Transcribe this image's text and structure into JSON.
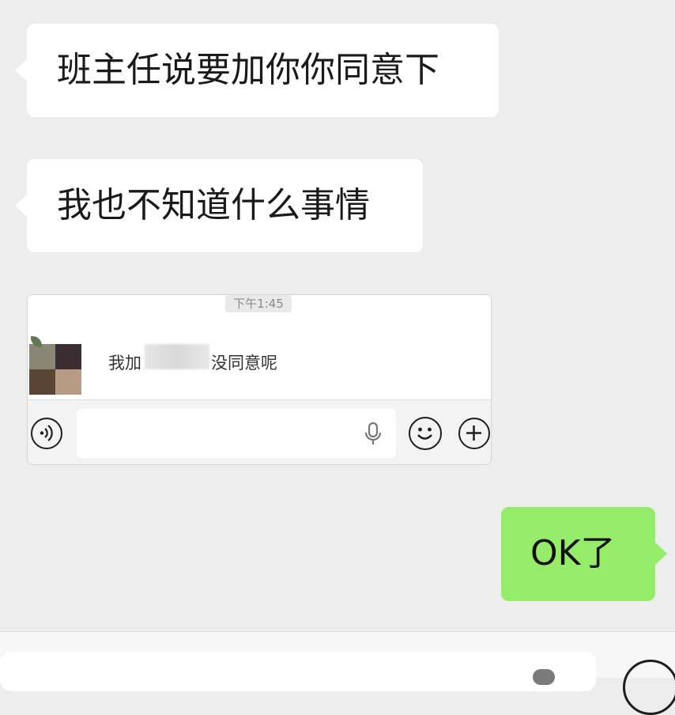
{
  "messages": {
    "m1": "班主任说要加你你同意下",
    "m2": "我也不知道什么事情",
    "reply": "OK了"
  },
  "screenshot": {
    "time": "下午1:45",
    "msg_prefix": "我加",
    "msg_suffix": "没同意呢",
    "icons": [
      "voice-icon",
      "microphone-icon",
      "emoji-icon",
      "plus-icon"
    ]
  },
  "colors": {
    "background": "#ededed",
    "incoming_bubble": "#ffffff",
    "outgoing_bubble": "#95ec69"
  }
}
